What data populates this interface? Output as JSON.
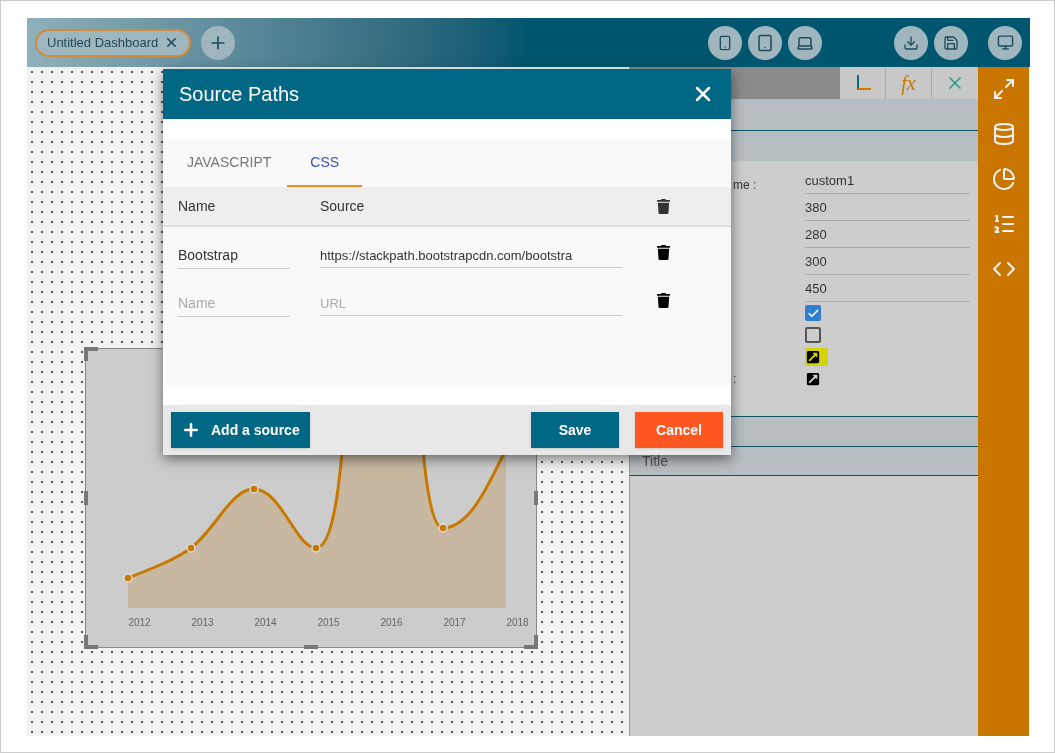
{
  "topbar": {
    "tab": {
      "label": "Untitled Dashboard"
    }
  },
  "chart": {
    "x_labels": [
      "2012",
      "2013",
      "2014",
      "2015",
      "2016",
      "2017",
      "2018"
    ]
  },
  "panel": {
    "toolbar": {
      "fx": "fx"
    },
    "properties": [
      {
        "kind": "text",
        "label": "me :",
        "value": "custom1"
      },
      {
        "kind": "text",
        "value": "380"
      },
      {
        "kind": "text",
        "value": "280"
      },
      {
        "kind": "text",
        "value": "300"
      },
      {
        "kind": "text",
        "value": "450"
      },
      {
        "kind": "checkbox",
        "checked": true
      },
      {
        "kind": "checkbox",
        "checked": false
      },
      {
        "kind": "link",
        "highlighted": true
      },
      {
        "kind": "link",
        "label": ":",
        "highlighted": false
      }
    ],
    "sections": [
      {
        "title": "Title"
      }
    ]
  },
  "dialog": {
    "title": "Source Paths",
    "tabs": [
      {
        "label": "JAVASCRIPT",
        "selected": false
      },
      {
        "label": "CSS",
        "selected": true
      }
    ],
    "columns": [
      "Name",
      "Source"
    ],
    "rows": [
      {
        "name": "Bootstrap",
        "source": "https://stackpath.bootstrapcdn.com/bootstra"
      },
      {
        "name_placeholder": "Name",
        "source_placeholder": "URL"
      }
    ],
    "add_button": "Add a source",
    "save_button": "Save",
    "cancel_button": "Cancel"
  }
}
